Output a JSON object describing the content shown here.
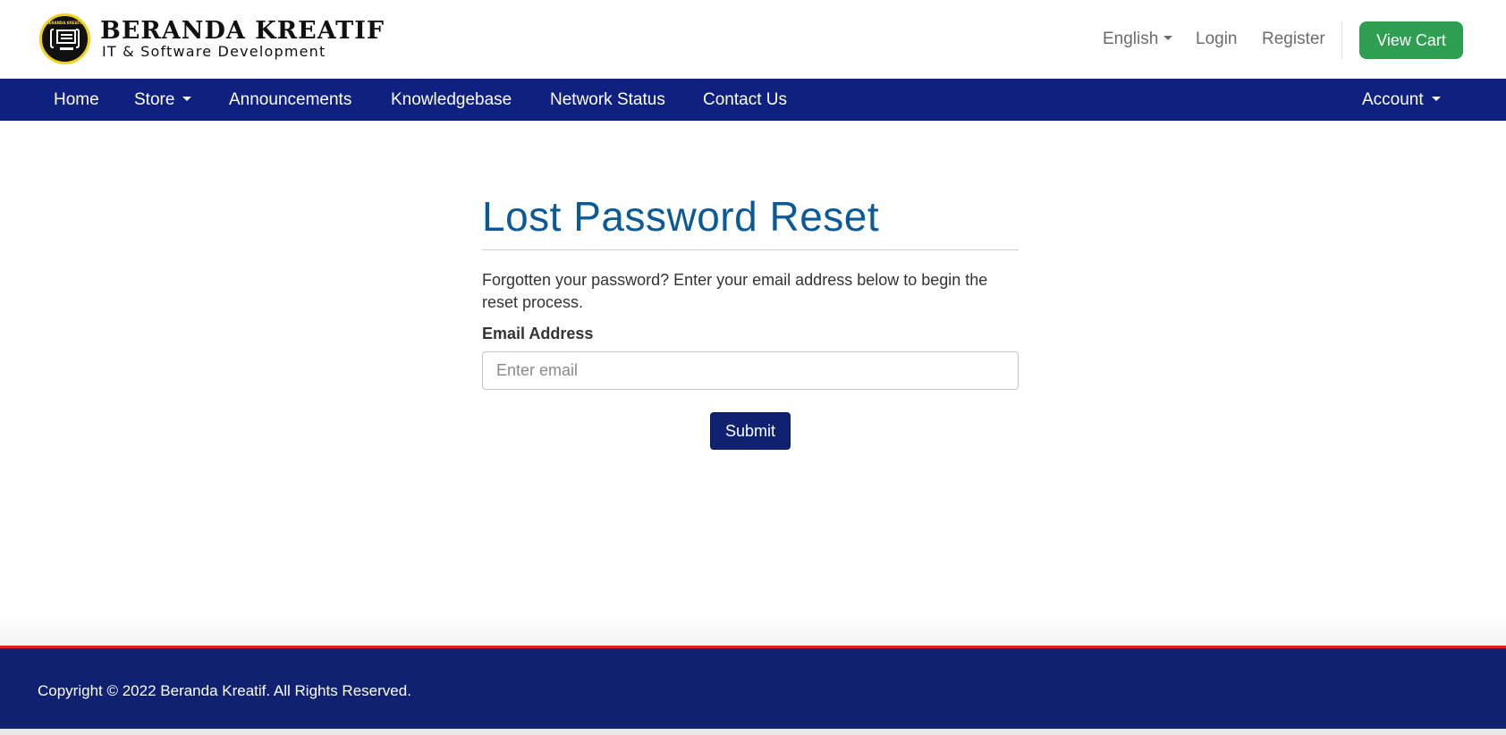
{
  "brand": {
    "title": "BERANDA KREATIF",
    "subtitle": "IT & Software Development",
    "logo_ring_text": "BERANDA KREATIF"
  },
  "top_links": {
    "language": "English",
    "login": "Login",
    "register": "Register",
    "view_cart": "View Cart"
  },
  "nav": {
    "home": "Home",
    "store": "Store",
    "announcements": "Announcements",
    "knowledgebase": "Knowledgebase",
    "network_status": "Network Status",
    "contact_us": "Contact Us",
    "account": "Account"
  },
  "main": {
    "title": "Lost Password Reset",
    "intro": "Forgotten your password? Enter your email address below to begin the reset process.",
    "email_label": "Email Address",
    "email_value": "",
    "email_placeholder": "Enter email",
    "submit_label": "Submit"
  },
  "footer": {
    "copyright": "Copyright © 2022 Beranda Kreatif. All Rights Reserved."
  },
  "colors": {
    "navbar": "#0f2180",
    "footer": "#0f2170",
    "footer_accent": "#d8202a",
    "cart_button": "#2e9e50",
    "title": "#0b5a97"
  }
}
